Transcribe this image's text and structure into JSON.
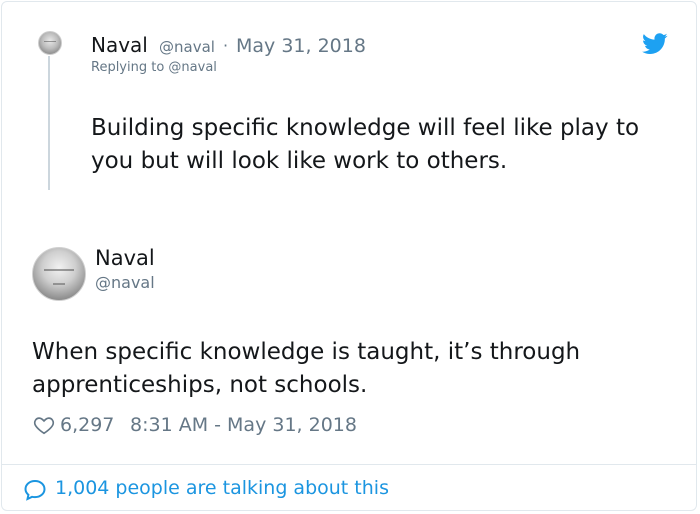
{
  "reply": {
    "name": "Naval",
    "handle": "@naval",
    "separator": "·",
    "date": "May 31, 2018",
    "replying_to": "Replying to @naval",
    "text": "Building specific knowledge will feel like play to you but will look like work to others."
  },
  "main": {
    "name": "Naval",
    "handle": "@naval",
    "text": "When specific knowledge is taught, it’s through apprenticeships, not schools.",
    "likes": "6,297",
    "timestamp": "8:31 AM - May 31, 2018"
  },
  "footer": {
    "talking": "1,004 people are talking about this"
  },
  "icons": {
    "brand": "twitter-bird-icon",
    "like": "heart-icon",
    "conversation": "speech-bubble-icon"
  },
  "colors": {
    "brand_blue": "#1da1f2",
    "link_blue": "#1b95e0",
    "muted": "#657786",
    "text": "#14171a"
  }
}
